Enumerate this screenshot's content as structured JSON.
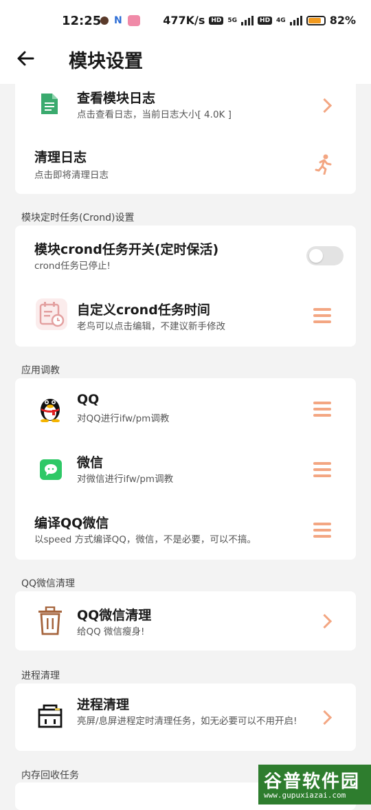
{
  "status_bar": {
    "time": "12:25",
    "speed": "477K/s",
    "net1": "5G",
    "net2": "4G",
    "battery": "82%",
    "battery_level": 0.82
  },
  "header": {
    "back_icon": "arrow-left-icon",
    "title": "模块设置"
  },
  "sections": {
    "log": {
      "view_title": "查看模块日志",
      "view_sub": "点击查看日志，当前日志大小[ 4.0K ]",
      "clear_title": "清理日志",
      "clear_sub": "点击即将清理日志"
    },
    "crond": {
      "label": "模块定时任务(Crond)设置",
      "switch_title": "模块crond任务开关(定时保活)",
      "switch_sub": "crond任务已停止!",
      "switch_on": false,
      "custom_title": "自定义crond任务时间",
      "custom_sub": "老鸟可以点击编辑，不建议新手修改"
    },
    "apps": {
      "label": "应用调教",
      "qq_title": "QQ",
      "qq_sub": "对QQ进行ifw/pm调教",
      "wx_title": "微信",
      "wx_sub": "对微信进行ifw/pm调教",
      "compile_title": "编译QQ微信",
      "compile_sub": "以speed 方式编译QQ，微信，不是必要，可以不搞。"
    },
    "qqwx_clean": {
      "label": "QQ微信清理",
      "title": "QQ微信清理",
      "sub": "给QQ 微信瘦身!"
    },
    "process": {
      "label": "进程清理",
      "title": "进程清理",
      "sub": "亮屏/息屏进程定时清理任务，如无必要可以不用开启!"
    },
    "memory": {
      "label": "内存回收任务"
    }
  },
  "watermark": {
    "big": "谷普软件园",
    "small": "www.gupuxiazai.com"
  },
  "colors": {
    "accent": "#f3a682",
    "toggle_off": "#e3e3e3",
    "wechat_green": "#2ec866",
    "doc_green": "#3aaa6e"
  }
}
